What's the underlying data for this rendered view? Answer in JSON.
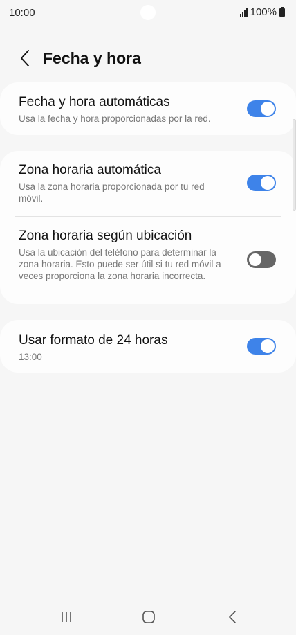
{
  "status_bar": {
    "time": "10:00",
    "battery": "100%",
    "icons": [
      "signal-icon",
      "battery-icon"
    ]
  },
  "header": {
    "title": "Fecha y hora",
    "back_icon": "chevron-left-icon"
  },
  "settings": {
    "auto_datetime": {
      "title": "Fecha y hora automáticas",
      "subtitle": "Usa la fecha y hora proporcionadas por la red.",
      "enabled": true
    },
    "auto_timezone": {
      "title": "Zona horaria automática",
      "subtitle": "Usa la zona horaria proporcionada por tu red móvil.",
      "enabled": true
    },
    "location_timezone": {
      "title": "Zona horaria según ubicación",
      "subtitle": "Usa la ubicación del teléfono para determinar la zona horaria. Esto puede ser útil si tu red móvil a veces proporciona la zona horaria incorrecta.",
      "enabled": false
    },
    "format_24h": {
      "title": "Usar formato de 24 horas",
      "subtitle": "13:00",
      "enabled": true
    }
  },
  "colors": {
    "accent": "#3e83e9",
    "background": "#f6f6f6",
    "card": "#fdfdfd"
  },
  "nav_bar": {
    "icons": [
      "recent-apps-icon",
      "home-icon",
      "back-icon"
    ]
  }
}
